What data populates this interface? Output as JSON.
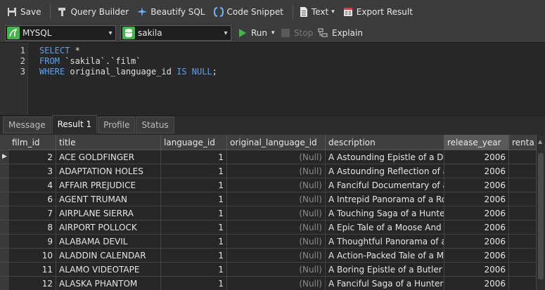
{
  "toolbar": {
    "save": "Save",
    "query_builder": "Query Builder",
    "beautify": "Beautify SQL",
    "code_snippet": "Code Snippet",
    "text": "Text",
    "export": "Export Result"
  },
  "toolbar2": {
    "connection": "MYSQL",
    "database": "sakila",
    "run": "Run",
    "stop": "Stop",
    "explain": "Explain"
  },
  "editor": {
    "line_numbers": [
      "1",
      "2",
      "3"
    ],
    "line1_kw": "SELECT",
    "line1_rest": " *",
    "line2_kw": "FROM",
    "line2_rest": " `sakila`.`film`",
    "line3_kw1": "WHERE",
    "line3_mid": " original_language_id ",
    "line3_kw2": "IS NULL",
    "line3_end": ";"
  },
  "tabs": [
    "Message",
    "Result 1",
    "Profile",
    "Status"
  ],
  "columns": [
    "film_id",
    "title",
    "language_id",
    "original_language_id",
    "description",
    "release_year",
    "renta"
  ],
  "rows": [
    {
      "film_id": "2",
      "title": "ACE GOLDFINGER",
      "language_id": "1",
      "original_language_id": "(Null)",
      "description": "A Astounding Epistle of a Datab",
      "release_year": "2006"
    },
    {
      "film_id": "3",
      "title": "ADAPTATION HOLES",
      "language_id": "1",
      "original_language_id": "(Null)",
      "description": "A Astounding Reflection of a Lu",
      "release_year": "2006"
    },
    {
      "film_id": "4",
      "title": "AFFAIR PREJUDICE",
      "language_id": "1",
      "original_language_id": "(Null)",
      "description": "A Fanciful Documentary of a Fr",
      "release_year": "2006"
    },
    {
      "film_id": "6",
      "title": "AGENT TRUMAN",
      "language_id": "1",
      "original_language_id": "(Null)",
      "description": "A Intrepid Panorama of a Robot",
      "release_year": "2006"
    },
    {
      "film_id": "7",
      "title": "AIRPLANE SIERRA",
      "language_id": "1",
      "original_language_id": "(Null)",
      "description": "A Touching Saga of a Hunter A",
      "release_year": "2006"
    },
    {
      "film_id": "8",
      "title": "AIRPORT POLLOCK",
      "language_id": "1",
      "original_language_id": "(Null)",
      "description": "A Epic Tale of a Moose And a G",
      "release_year": "2006"
    },
    {
      "film_id": "9",
      "title": "ALABAMA DEVIL",
      "language_id": "1",
      "original_language_id": "(Null)",
      "description": "A Thoughtful Panorama of a Da",
      "release_year": "2006"
    },
    {
      "film_id": "10",
      "title": "ALADDIN CALENDAR",
      "language_id": "1",
      "original_language_id": "(Null)",
      "description": "A Action-Packed Tale of a Man",
      "release_year": "2006"
    },
    {
      "film_id": "11",
      "title": "ALAMO VIDEOTAPE",
      "language_id": "1",
      "original_language_id": "(Null)",
      "description": "A Boring Epistle of a Butler And",
      "release_year": "2006"
    },
    {
      "film_id": "12",
      "title": "ALASKA PHANTOM",
      "language_id": "1",
      "original_language_id": "(Null)",
      "description": "A Fanciful Saga of a Hunter An",
      "release_year": "2006"
    }
  ],
  "icons": {
    "save": "save-icon",
    "query_builder": "query-builder-icon",
    "beautify": "beautify-icon",
    "code_snippet": "code-snippet-icon",
    "text": "text-icon",
    "export": "export-icon",
    "connection": "mysql-icon",
    "database": "database-icon",
    "run": "play-icon",
    "stop": "stop-icon",
    "explain": "explain-icon"
  },
  "colors": {
    "accent_green": "#3fb54a",
    "keyword_blue": "#5fa0e8",
    "null_gray": "#8c8c8c"
  }
}
